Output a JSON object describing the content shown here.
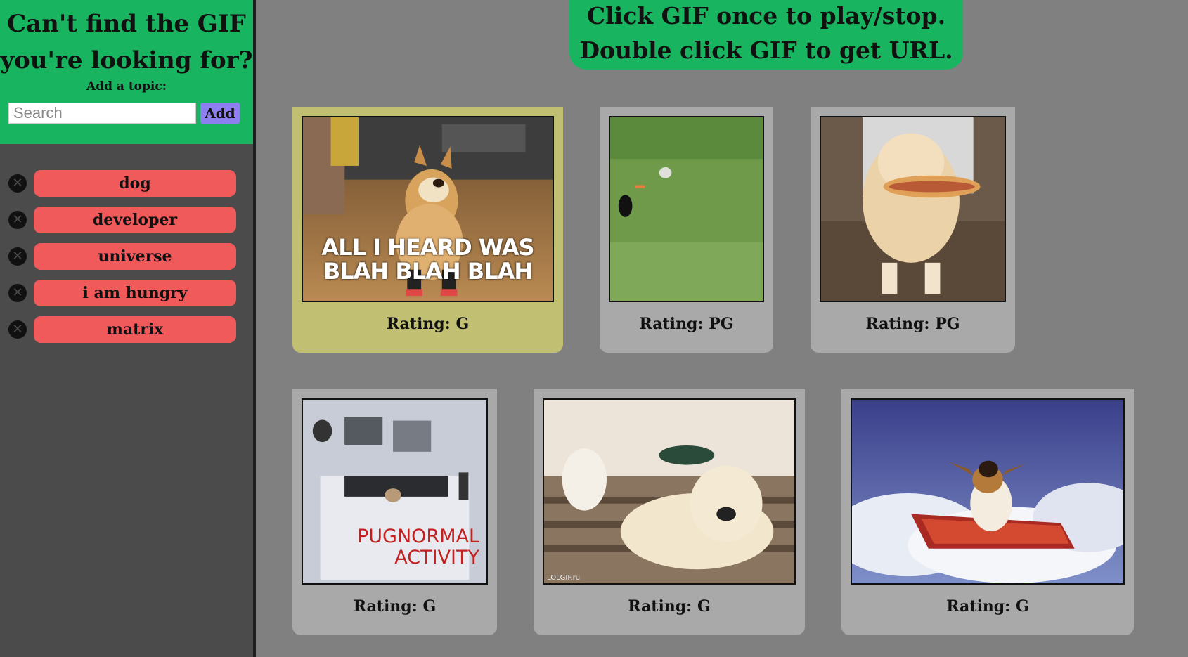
{
  "sidebar": {
    "title_line1": "Can't find the GIF",
    "title_line2": "you're looking for?",
    "add_label": "Add a topic:",
    "search_placeholder": "Search",
    "add_button": "Add",
    "topics": [
      {
        "label": "dog"
      },
      {
        "label": "developer"
      },
      {
        "label": "universe"
      },
      {
        "label": "i am hungry"
      },
      {
        "label": "matrix"
      }
    ]
  },
  "banner": {
    "line1": "Click GIF once to play/stop.",
    "line2": "Double click GIF to get URL."
  },
  "gifs": [
    {
      "rating": "Rating: G",
      "caption_line1": "ALL I HEARD WAS",
      "caption_line2": "BLAH BLAH BLAH"
    },
    {
      "rating": "Rating: PG"
    },
    {
      "rating": "Rating: PG"
    },
    {
      "rating": "Rating: G",
      "caption_line1": "PUGNORMAL",
      "caption_line2": "ACTIVITY"
    },
    {
      "rating": "Rating: G",
      "watermark": "LOLGIF.ru"
    },
    {
      "rating": "Rating: G"
    }
  ],
  "colors": {
    "accent_green": "#19b45f",
    "topic_red": "#f05a5a",
    "add_purple": "#8e7ff0",
    "active_card": "#c1c072"
  }
}
